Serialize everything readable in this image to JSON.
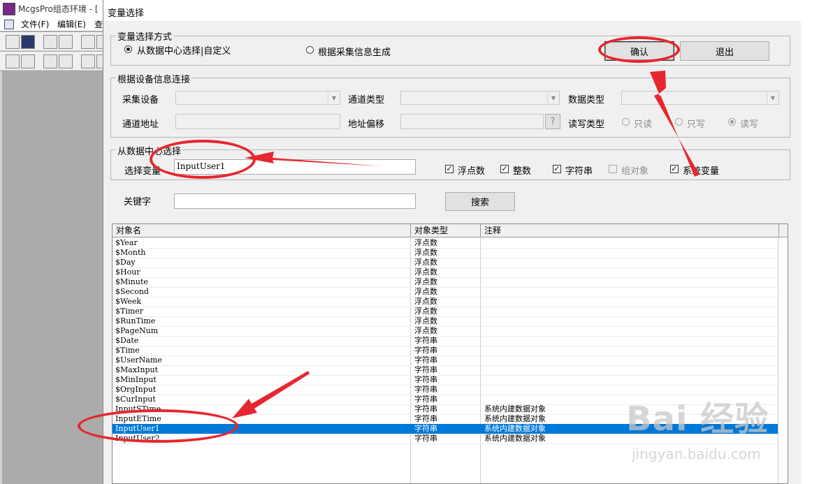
{
  "app": {
    "title": "McgsPro组态环境 - [",
    "menu": [
      "文件(F)",
      "编辑(E)",
      "查"
    ]
  },
  "dialog": {
    "title": "变量选择",
    "mode_group": {
      "legend": "变量选择方式",
      "option1": "从数据中心选择|自定义",
      "option2": "根据采集信息生成",
      "confirm": "确认",
      "exit": "退出"
    },
    "device_group": {
      "legend": "根据设备信息连接",
      "device_label": "采集设备",
      "channel_type_label": "通道类型",
      "data_type_label": "数据类型",
      "channel_addr_label": "通道地址",
      "addr_offset_label": "地址偏移",
      "help": "?",
      "rw_type_label": "读写类型",
      "read_only": "只读",
      "write_only": "只写",
      "read_write": "读写"
    },
    "datacenter_group": {
      "legend": "从数据中心选择",
      "select_var_label": "选择变量",
      "select_var_value": "InputUser1",
      "float": "浮点数",
      "integer": "整数",
      "string": "字符串",
      "group_object": "组对象",
      "system_var": "系统变量"
    },
    "keyword_label": "关键字",
    "keyword_value": "",
    "search": "搜索",
    "list": {
      "headers": [
        "对象名",
        "对象类型",
        "注释"
      ],
      "rows": [
        {
          "name": "$Year",
          "type": "浮点数",
          "note": ""
        },
        {
          "name": "$Month",
          "type": "浮点数",
          "note": ""
        },
        {
          "name": "$Day",
          "type": "浮点数",
          "note": ""
        },
        {
          "name": "$Hour",
          "type": "浮点数",
          "note": ""
        },
        {
          "name": "$Minute",
          "type": "浮点数",
          "note": ""
        },
        {
          "name": "$Second",
          "type": "浮点数",
          "note": ""
        },
        {
          "name": "$Week",
          "type": "浮点数",
          "note": ""
        },
        {
          "name": "$Timer",
          "type": "浮点数",
          "note": ""
        },
        {
          "name": "$RunTime",
          "type": "浮点数",
          "note": ""
        },
        {
          "name": "$PageNum",
          "type": "浮点数",
          "note": ""
        },
        {
          "name": "$Date",
          "type": "字符串",
          "note": ""
        },
        {
          "name": "$Time",
          "type": "字符串",
          "note": ""
        },
        {
          "name": "$UserName",
          "type": "字符串",
          "note": ""
        },
        {
          "name": "$MaxInput",
          "type": "字符串",
          "note": ""
        },
        {
          "name": "$MinInput",
          "type": "字符串",
          "note": ""
        },
        {
          "name": "$OrgInput",
          "type": "字符串",
          "note": ""
        },
        {
          "name": "$CurInput",
          "type": "字符串",
          "note": ""
        },
        {
          "name": "InputSTime",
          "type": "字符串",
          "note": "系统内建数据对象"
        },
        {
          "name": "InputETime",
          "type": "字符串",
          "note": "系统内建数据对象"
        },
        {
          "name": "InputUser1",
          "type": "字符串",
          "note": "系统内建数据对象"
        },
        {
          "name": "InputUser2",
          "type": "字符串",
          "note": "系统内建数据对象"
        }
      ],
      "selected_index": 19
    }
  },
  "watermark": {
    "main": "Bai 经验",
    "sub": "jingyan.baidu.com"
  },
  "colors": {
    "annotation": "#e8262f",
    "selection": "#0078d7"
  }
}
